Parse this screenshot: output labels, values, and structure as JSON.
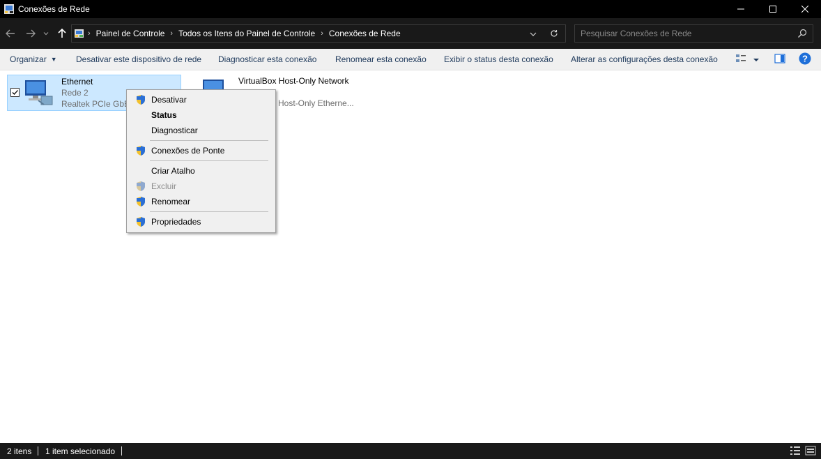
{
  "window": {
    "title": "Conexões de Rede",
    "controls": [
      "minimize",
      "maximize",
      "close"
    ]
  },
  "address_bar": {
    "breadcrumb": [
      "Painel de Controle",
      "Todos os Itens do Painel de Controle",
      "Conexões de Rede"
    ]
  },
  "search": {
    "placeholder": "Pesquisar Conexões de Rede"
  },
  "command_bar": {
    "organize": "Organizar",
    "commands": [
      "Desativar este dispositivo de rede",
      "Diagnosticar esta conexão",
      "Renomear esta conexão",
      "Exibir o status desta conexão",
      "Alterar as configurações desta conexão"
    ]
  },
  "items": [
    {
      "name": "Ethernet",
      "network": "Rede 2",
      "adapter": "Realtek PCIe GbE",
      "selected": true,
      "checked": true
    },
    {
      "name": "VirtualBox Host-Only Network",
      "network": "",
      "adapter": "Host-Only Etherne...",
      "selected": false
    }
  ],
  "context_menu": {
    "items": [
      {
        "label": "Desativar",
        "shield": true,
        "bold": false,
        "disabled": false
      },
      {
        "label": "Status",
        "shield": false,
        "bold": true,
        "disabled": false
      },
      {
        "label": "Diagnosticar",
        "shield": false,
        "bold": false,
        "disabled": false
      },
      {
        "label": "Conexões de Ponte",
        "shield": true,
        "bold": false,
        "disabled": false
      },
      {
        "label": "Criar Atalho",
        "shield": false,
        "bold": false,
        "disabled": false
      },
      {
        "label": "Excluir",
        "shield": true,
        "bold": false,
        "disabled": true
      },
      {
        "label": "Renomear",
        "shield": true,
        "bold": false,
        "disabled": false
      },
      {
        "label": "Propriedades",
        "shield": true,
        "bold": false,
        "disabled": false
      }
    ]
  },
  "status_bar": {
    "count": "2 itens",
    "selection": "1 item selecionado"
  },
  "colors": {
    "titlebar": "#000000",
    "navbar": "#191919",
    "selection": "#cce8ff",
    "accent_link": "#1e395b",
    "help_icon": "#1e6fd9"
  }
}
